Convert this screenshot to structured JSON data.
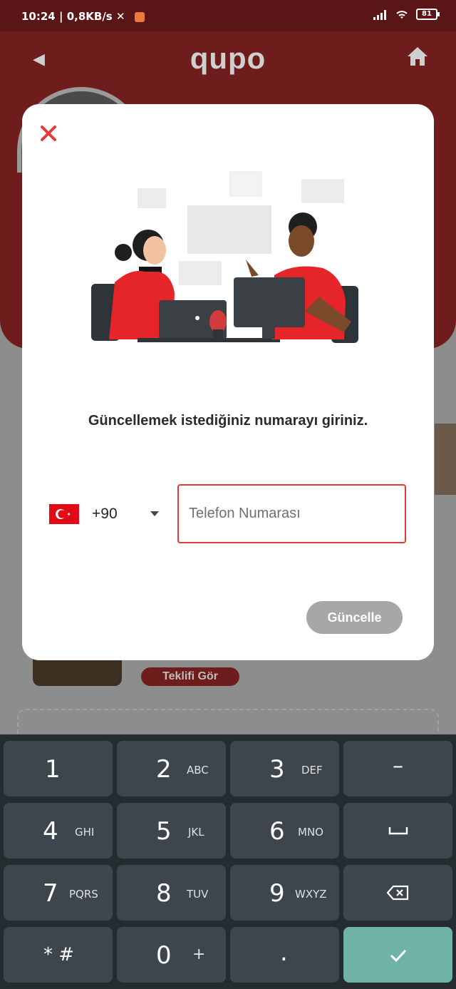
{
  "status_bar": {
    "time": "10:24",
    "net_speed": "0,8KB/s",
    "battery": "81"
  },
  "app": {
    "logo": "qupo",
    "offer_button": "Teklifi Gör"
  },
  "dialog": {
    "prompt": "Güncellemek istediğiniz numarayı giriniz.",
    "country_code": "+90",
    "phone_placeholder": "Telefon Numarası",
    "update_button": "Güncelle",
    "accent_color": "#e53935"
  },
  "keyboard": {
    "keys": [
      {
        "num": "1",
        "letters": ""
      },
      {
        "num": "2",
        "letters": "ABC"
      },
      {
        "num": "3",
        "letters": "DEF"
      },
      {
        "sym": "–"
      },
      {
        "num": "4",
        "letters": "GHI"
      },
      {
        "num": "5",
        "letters": "JKL"
      },
      {
        "num": "6",
        "letters": "MNO"
      },
      {
        "sym": "space-icon"
      },
      {
        "num": "7",
        "letters": "PQRS"
      },
      {
        "num": "8",
        "letters": "TUV"
      },
      {
        "num": "9",
        "letters": "WXYZ"
      },
      {
        "sym": "backspace-icon"
      },
      {
        "num": "* #",
        "letters": ""
      },
      {
        "num": "0",
        "letters": "+"
      },
      {
        "num": ".",
        "letters": ""
      },
      {
        "sym": "check-icon"
      }
    ]
  }
}
